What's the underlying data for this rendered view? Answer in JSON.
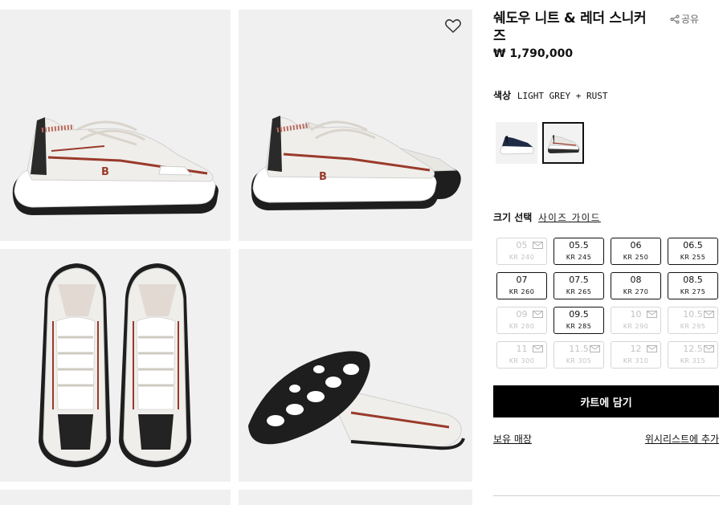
{
  "product": {
    "title": "쉐도우 니트 & 레더 스니커즈",
    "price": "₩ 1,790,000",
    "share_label": "공유"
  },
  "color": {
    "label": "색상",
    "value": "LIGHT GREY + RUST",
    "swatches": [
      {
        "name": "navy",
        "color": "#1f2a44",
        "selected": false
      },
      {
        "name": "light-grey-rust",
        "color": "#e9e6e1",
        "selected": true
      }
    ]
  },
  "size": {
    "label": "크기 선택",
    "guide_link": "사이즈 가이드",
    "options": [
      {
        "eu": "05",
        "kr": "KR 240",
        "available": false
      },
      {
        "eu": "05.5",
        "kr": "KR 245",
        "available": true
      },
      {
        "eu": "06",
        "kr": "KR 250",
        "available": true
      },
      {
        "eu": "06.5",
        "kr": "KR 255",
        "available": true
      },
      {
        "eu": "07",
        "kr": "KR 260",
        "available": true
      },
      {
        "eu": "07.5",
        "kr": "KR 265",
        "available": true
      },
      {
        "eu": "08",
        "kr": "KR 270",
        "available": true
      },
      {
        "eu": "08.5",
        "kr": "KR 275",
        "available": true
      },
      {
        "eu": "09",
        "kr": "KR 280",
        "available": false
      },
      {
        "eu": "09.5",
        "kr": "KR 285",
        "available": true
      },
      {
        "eu": "10",
        "kr": "KR 290",
        "available": false
      },
      {
        "eu": "10.5",
        "kr": "KR 295",
        "available": false
      },
      {
        "eu": "11",
        "kr": "KR 300",
        "available": false
      },
      {
        "eu": "11.5",
        "kr": "KR 305",
        "available": false
      },
      {
        "eu": "12",
        "kr": "KR 310",
        "available": false
      },
      {
        "eu": "12.5",
        "kr": "KR 315",
        "available": false
      }
    ]
  },
  "actions": {
    "add_to_cart": "카트에 담기",
    "store_stock": "보유 매장",
    "add_to_wishlist": "위시리스트에 추가"
  },
  "icons": {
    "wishlist": "heart-icon",
    "share": "share-icon",
    "notify": "mail-icon"
  }
}
